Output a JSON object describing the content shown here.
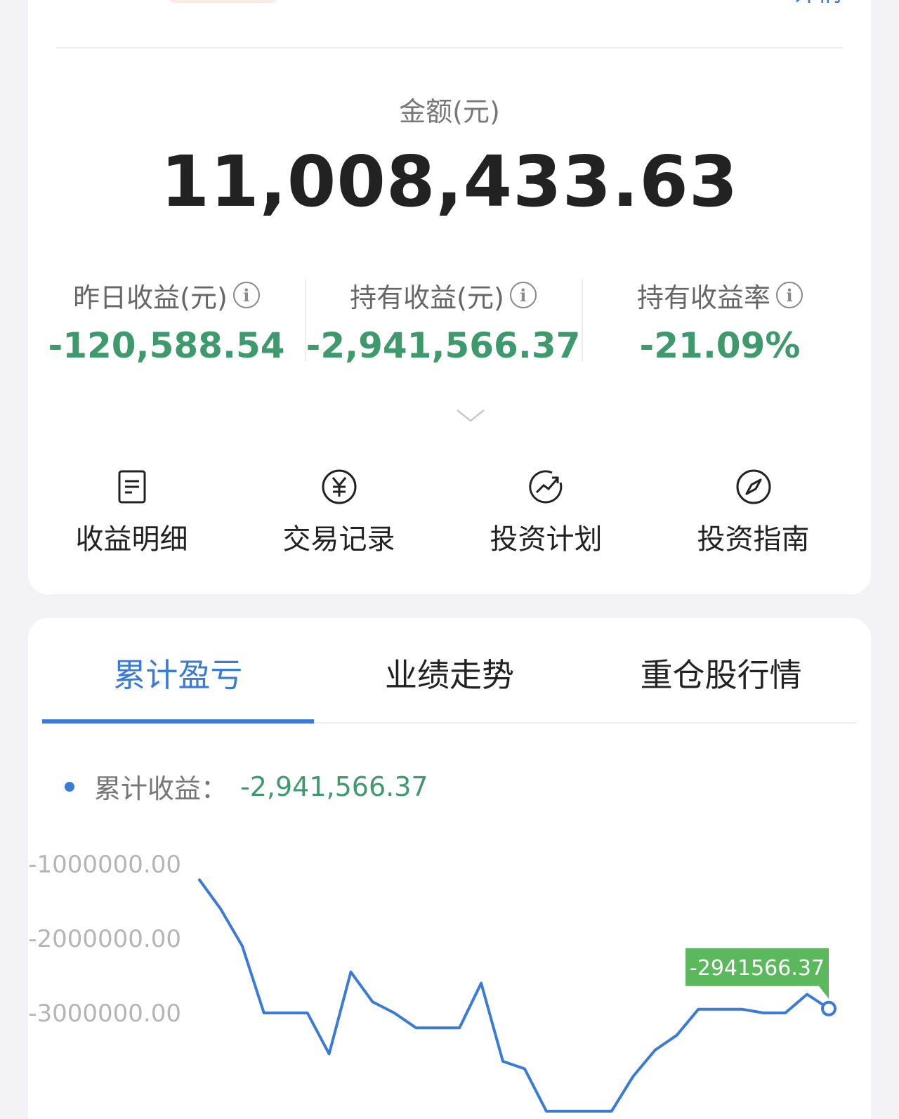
{
  "header": {
    "top_link": "详情"
  },
  "summary": {
    "amount_label": "金额(元)",
    "amount_value": "11,008,433.63"
  },
  "stats": [
    {
      "label": "昨日收益(元)",
      "value": "-120,588.54"
    },
    {
      "label": "持有收益(元)",
      "value": "-2,941,566.37"
    },
    {
      "label": "持有收益率",
      "value": "-21.09%"
    }
  ],
  "shortcuts": [
    {
      "label": "收益明细",
      "icon": "document-icon"
    },
    {
      "label": "交易记录",
      "icon": "yuan-icon"
    },
    {
      "label": "投资计划",
      "icon": "trend-icon"
    },
    {
      "label": "投资指南",
      "icon": "compass-icon"
    }
  ],
  "tabs": [
    {
      "label": "累计盈亏",
      "active": true
    },
    {
      "label": "业绩走势",
      "active": false
    },
    {
      "label": "重仓股行情",
      "active": false
    }
  ],
  "legend": {
    "label": "累计收益：",
    "value": "-2,941,566.37"
  },
  "colors": {
    "accent": "#3a7bd5",
    "loss_green": "#3e9a6d",
    "tooltip_bg": "#5cb85c"
  },
  "chart_data": {
    "type": "line",
    "yticks": [
      {
        "value": -1000000,
        "label": "-1000000.00"
      },
      {
        "value": -2000000,
        "label": "-2000000.00"
      },
      {
        "value": -3000000,
        "label": "-3000000.00"
      }
    ],
    "ylim": [
      -4300000,
      -1000000
    ],
    "series": [
      {
        "values": [
          -1200000,
          -1600000,
          -2100000,
          -3000000,
          -3000000,
          -3000000,
          -3550000,
          -2450000,
          -2850000,
          -3000000,
          -3200000,
          -3200000,
          -3200000,
          -2600000,
          -3650000,
          -3750000,
          -4320000,
          -4320000,
          -4320000,
          -4320000,
          -3850000,
          -3500000,
          -3300000,
          -2950000,
          -2950000,
          -2950000,
          -3000000,
          -3000000,
          -2750000,
          -2941566.37
        ]
      }
    ],
    "last_point_label": "-2941566.37"
  }
}
